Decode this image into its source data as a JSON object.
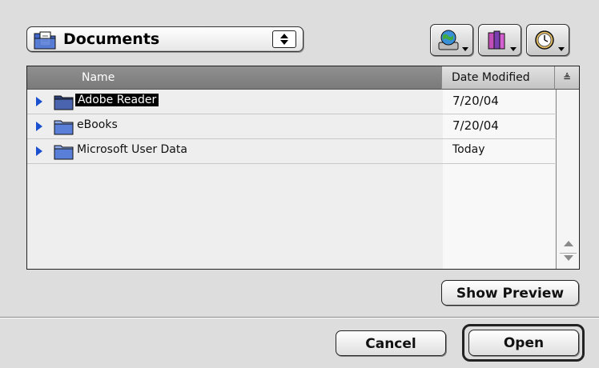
{
  "folder_popup": {
    "label": "Documents",
    "icon": "document-folder-icon"
  },
  "toolbar": {
    "buttons": [
      {
        "icon": "globe-drive-icon"
      },
      {
        "icon": "favorites-books-icon"
      },
      {
        "icon": "recent-clock-icon"
      }
    ]
  },
  "file_list": {
    "columns": {
      "name": "Name",
      "date": "Date Modified",
      "sort": "≜"
    },
    "rows": [
      {
        "name": "Adobe Reader",
        "date": "7/20/04",
        "selected": true
      },
      {
        "name": "eBooks",
        "date": "7/20/04",
        "selected": false
      },
      {
        "name": "Microsoft User Data",
        "date": "Today",
        "selected": false
      }
    ]
  },
  "buttons": {
    "preview": "Show Preview",
    "cancel": "Cancel",
    "open": "Open"
  },
  "colors": {
    "disclosure": "#1a4fd0",
    "folder": "#5a7fd8",
    "background": "#dddddd"
  }
}
